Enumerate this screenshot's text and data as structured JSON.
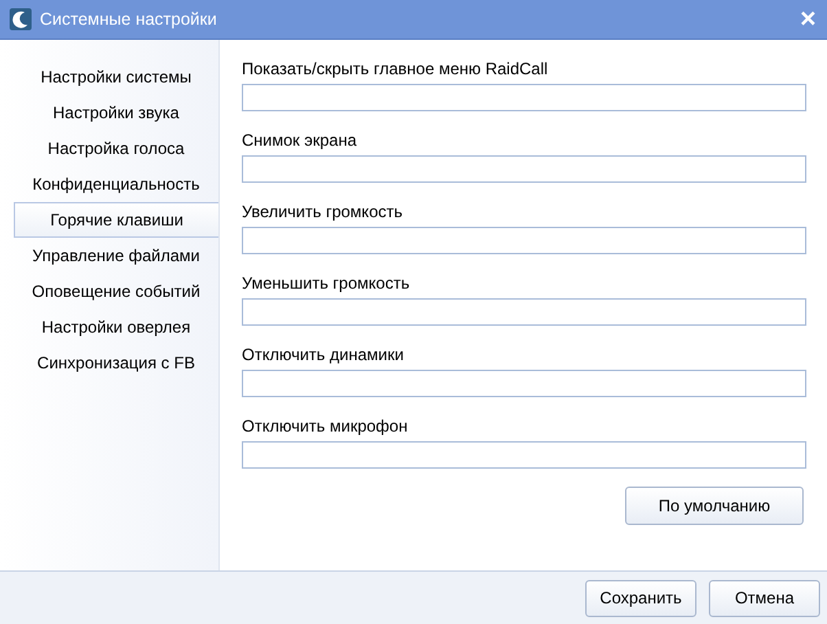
{
  "window": {
    "title": "Системные настройки",
    "close": "×"
  },
  "sidebar": {
    "items": [
      {
        "label": "Настройки системы",
        "selected": false
      },
      {
        "label": "Настройки звука",
        "selected": false
      },
      {
        "label": "Настройка голоса",
        "selected": false
      },
      {
        "label": "Конфиденциальность",
        "selected": false
      },
      {
        "label": "Горячие клавиши",
        "selected": true
      },
      {
        "label": "Управление файлами",
        "selected": false
      },
      {
        "label": "Оповещение событий",
        "selected": false
      },
      {
        "label": "Настройки оверлея",
        "selected": false
      },
      {
        "label": "Синхронизация с FB",
        "selected": false
      }
    ]
  },
  "hotkeys": [
    {
      "label": "Показать/скрыть главное меню RaidCall"
    },
    {
      "label": "Снимок экрана"
    },
    {
      "label": "Увеличить громкость"
    },
    {
      "label": "Уменьшить громкость"
    },
    {
      "label": "Отключить динамики"
    },
    {
      "label": "Отключить микрофон"
    }
  ],
  "default_button": "По умолчанию",
  "buttons": [
    "Сохранить",
    "Отмена"
  ]
}
